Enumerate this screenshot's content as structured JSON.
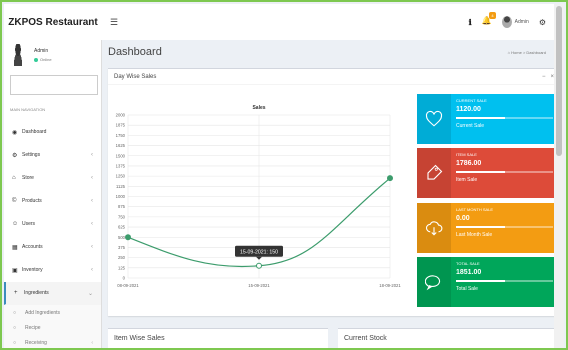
{
  "brand": {
    "title": "ZKPOS Restaurant"
  },
  "topbar": {
    "notification_count": "4",
    "user_label": "Admin"
  },
  "sidebar": {
    "user": {
      "name": "Admin",
      "status": "Online"
    },
    "search": {
      "placeholder": ""
    },
    "nav_header": "MAIN NAVIGATION",
    "items": [
      {
        "label": "Dashboard",
        "icon": "dashboard-icon"
      },
      {
        "label": "Settings",
        "icon": "gear-icon"
      },
      {
        "label": "Store",
        "icon": "home-icon"
      },
      {
        "label": "Products",
        "icon": "copyright-icon"
      },
      {
        "label": "Users",
        "icon": "user-icon"
      },
      {
        "label": "Accounts",
        "icon": "calculator-icon"
      },
      {
        "label": "Inventory",
        "icon": "archive-icon"
      },
      {
        "label": "Ingredients",
        "icon": "plus-icon"
      }
    ],
    "sub_items": [
      {
        "label": "Add Ingredients"
      },
      {
        "label": "Recipe"
      },
      {
        "label": "Receiving"
      }
    ]
  },
  "content": {
    "page_title": "Dashboard",
    "breadcrumb": {
      "home": "Home",
      "current": "Dashboard"
    }
  },
  "sales_box": {
    "title": "Day Wise Sales",
    "tooltip": "15-09-2021: 150"
  },
  "info_boxes": [
    {
      "title": "CURRENT SALE",
      "value": "1120.00",
      "desc": "Current Sale",
      "color": "#00c0ef",
      "icon": "heart-icon",
      "progress": 0.5
    },
    {
      "title": "ITEM SALE",
      "value": "1786.00",
      "desc": "Item Sale",
      "color": "#dd4b39",
      "icon": "tag-icon",
      "progress": 0.5
    },
    {
      "title": "LAST MONTH SALE",
      "value": "0.00",
      "desc": "Last Month Sale",
      "color": "#f39c12",
      "icon": "cloud-download-icon",
      "progress": 0.5
    },
    {
      "title": "TOTAL SALE",
      "value": "1851.00",
      "desc": "Total Sale",
      "color": "#00a65a",
      "icon": "comment-icon",
      "progress": 0.5
    }
  ],
  "bottom_boxes": [
    {
      "title": "Item Wise Sales"
    },
    {
      "title": "Current Stock"
    }
  ],
  "chart_data": {
    "type": "line",
    "title": "Sales",
    "categories": [
      "08-09-2021",
      "15-09-2021",
      "18-09-2021"
    ],
    "series": [
      {
        "values": [
          500,
          150,
          1225
        ]
      }
    ],
    "ylim": [
      0,
      2000
    ],
    "yticks": [
      0,
      125,
      250,
      375,
      500,
      625,
      750,
      875,
      1000,
      1125,
      1250,
      1375,
      1500,
      1625,
      1750,
      1875,
      2000
    ],
    "color": "#3c9c6c",
    "grid": true
  }
}
